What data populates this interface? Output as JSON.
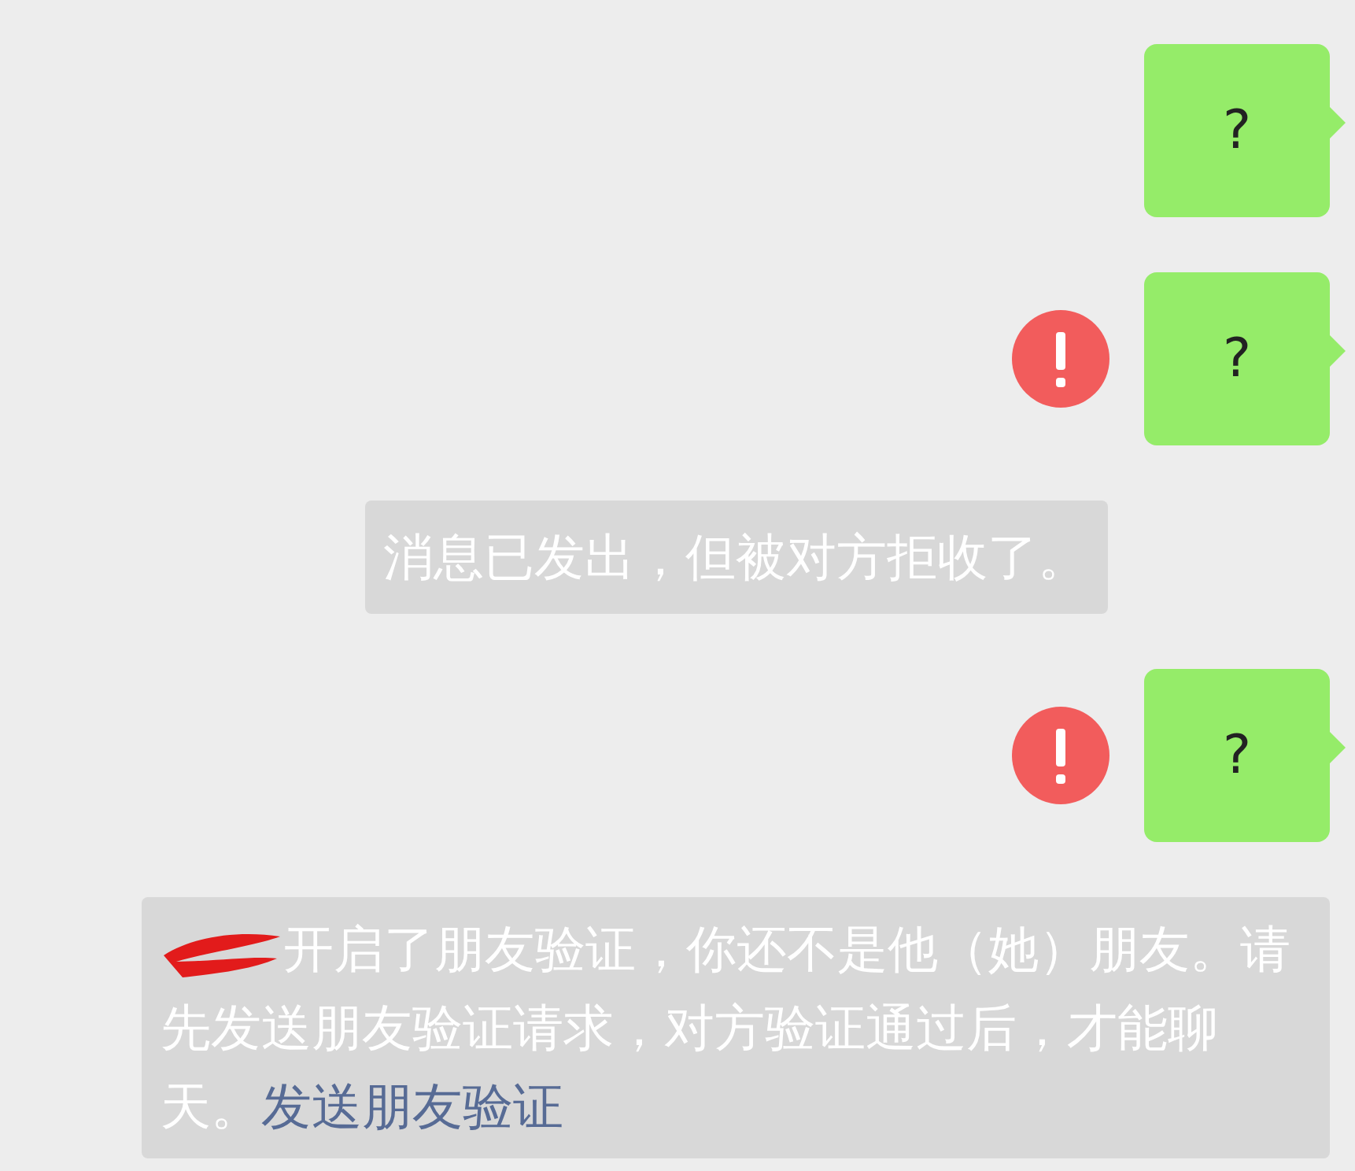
{
  "messages": [
    {
      "kind": "sent",
      "text": "?",
      "failed": false
    },
    {
      "kind": "sent",
      "text": "?",
      "failed": true
    },
    {
      "kind": "notice",
      "text": "消息已发出，但被对方拒收了。"
    },
    {
      "kind": "sent",
      "text": "?",
      "failed": true
    },
    {
      "kind": "notice",
      "redacted": true,
      "text": "开启了朋友验证，你还不是他（她）朋友。请先发送朋友验证请求，对方验证通过后，才能聊天。",
      "link": "发送朋友验证"
    }
  ]
}
